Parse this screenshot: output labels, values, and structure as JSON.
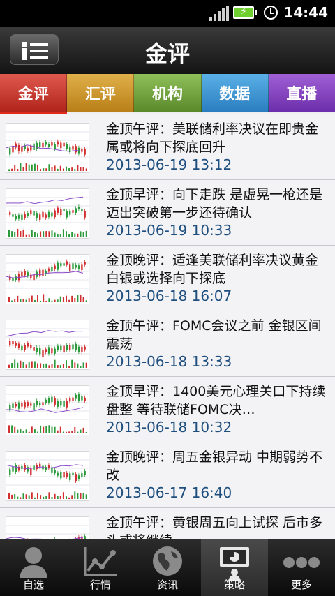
{
  "status_bar": {
    "time": "14:44"
  },
  "header": {
    "title": "金评"
  },
  "tabs": [
    {
      "label": "金评"
    },
    {
      "label": "汇评"
    },
    {
      "label": "机构"
    },
    {
      "label": "数据"
    },
    {
      "label": "直播"
    }
  ],
  "articles": [
    {
      "headline": "金顶午评：美联储利率决议在即贵金属或将向下探底回升",
      "date": "2013-06-19 13:12"
    },
    {
      "headline": "金顶早评：向下走跌 是虚晃一枪还是迈出突破第一步还待确认",
      "date": "2013-06-19 10:33"
    },
    {
      "headline": "金顶晚评：适逢美联储利率决议黄金白银或选择向下探底",
      "date": "2013-06-18 16:07"
    },
    {
      "headline": "金顶午评：FOMC会议之前 金银区间震荡",
      "date": "2013-06-18 13:33"
    },
    {
      "headline": "金顶早评：1400美元心理关口下持续盘整 等待联储FOMC决…",
      "date": "2013-06-18 10:32"
    },
    {
      "headline": "金顶晚评：周五金银异动 中期弱势不改",
      "date": "2013-06-17 16:40"
    },
    {
      "headline": "金顶午评：黄银周五向上试探 后市多头或将继续",
      "date": ""
    }
  ],
  "bottom_nav": [
    {
      "label": "自选",
      "icon": "person-icon"
    },
    {
      "label": "行情",
      "icon": "line-chart-icon"
    },
    {
      "label": "资讯",
      "icon": "globe-icon"
    },
    {
      "label": "策略",
      "icon": "presentation-board-icon"
    },
    {
      "label": "更多",
      "icon": "more-dots-icon"
    }
  ],
  "colors": {
    "tab_active_indicator": "#e02a1a",
    "date_text": "#1e4e7e"
  }
}
